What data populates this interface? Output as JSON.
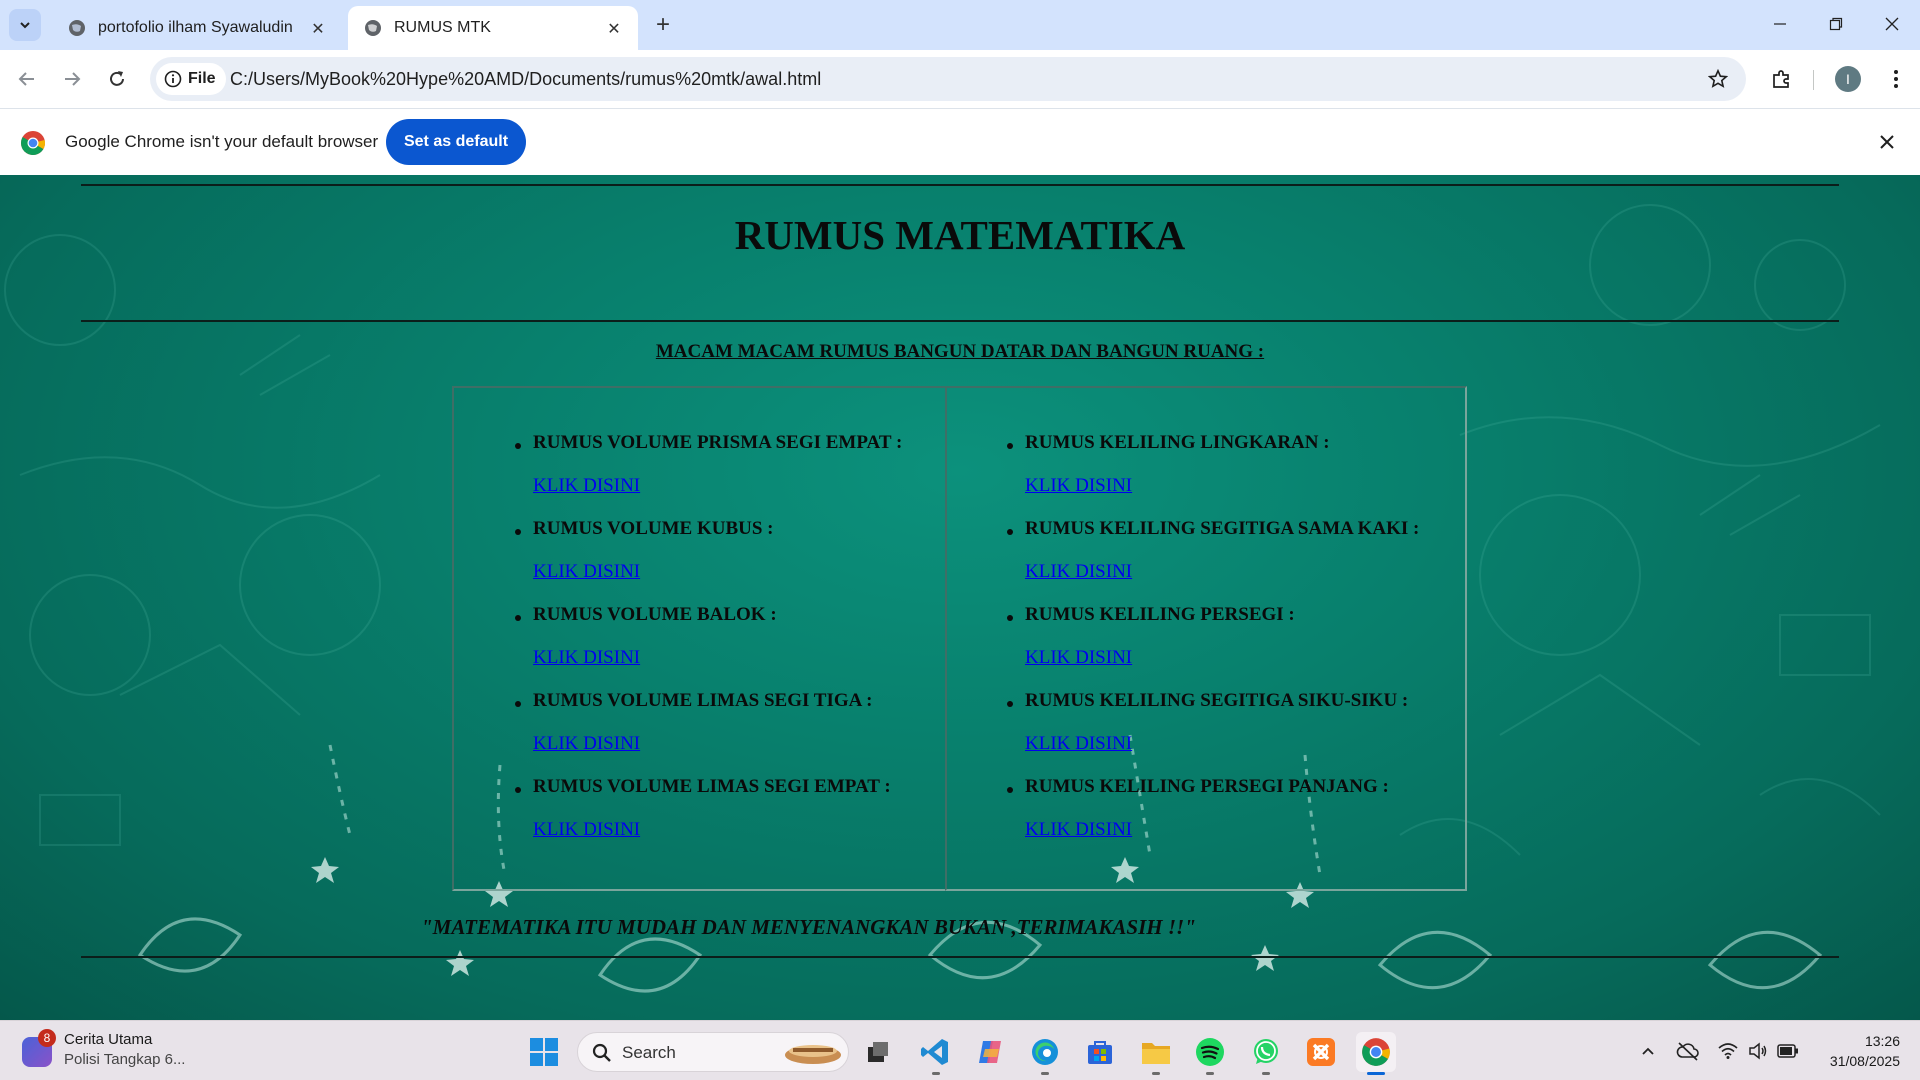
{
  "browser": {
    "tabs": [
      {
        "title": "portofolio ilham Syawaludin",
        "active": false
      },
      {
        "title": "RUMUS MTK",
        "active": true
      }
    ],
    "address": {
      "scheme_chip": "File",
      "url": "C:/Users/MyBook%20Hype%20AMD/Documents/rumus%20mtk/awal.html"
    },
    "profile_initial": "I",
    "infobar": {
      "message": "Google Chrome isn't your default browser",
      "button": "Set as default"
    }
  },
  "page": {
    "title": "RUMUS MATEMATIKA",
    "subtitle": "MACAM MACAM RUMUS BANGUN DATAR DAN BANGUN RUANG :",
    "left_column": [
      {
        "label": "RUMUS VOLUME PRISMA SEGI EMPAT :",
        "link": "KLIK DISINI"
      },
      {
        "label": "RUMUS VOLUME KUBUS :",
        "link": "KLIK DISINI"
      },
      {
        "label": "RUMUS VOLUME BALOK :",
        "link": "KLIK DISINI"
      },
      {
        "label": "RUMUS VOLUME LIMAS SEGI TIGA :",
        "link": "KLIK DISINI"
      },
      {
        "label": "RUMUS VOLUME LIMAS SEGI EMPAT :",
        "link": "KLIK DISINI"
      }
    ],
    "right_column": [
      {
        "label": "RUMUS KELILING LINGKARAN :",
        "link": "KLIK DISINI"
      },
      {
        "label": "RUMUS KELILING SEGITIGA SAMA KAKI :",
        "link": "KLIK DISINI"
      },
      {
        "label": "RUMUS KELILING PERSEGI :",
        "link": "KLIK DISINI"
      },
      {
        "label": "RUMUS KELILING SEGITIGA SIKU-SIKU :",
        "link": "KLIK DISINI"
      },
      {
        "label": "RUMUS KELILING PERSEGI PANJANG :",
        "link": "KLIK DISINI"
      }
    ],
    "quote": "\"MATEMATIKA ITU MUDAH DAN MENYENANGKAN BUKAN ,TERIMAKASIH !!\"",
    "colors": {
      "background": "#08806d",
      "text": "#0a0a0a",
      "link": "#0000ee"
    }
  },
  "taskbar": {
    "news": {
      "badge": "8",
      "title": "Cerita Utama",
      "subtitle": "Polisi Tangkap 6..."
    },
    "search_label": "Search",
    "apps": [
      "start-icon",
      "search-icon",
      "task-view-icon",
      "vscode-icon",
      "copilot-icon",
      "edge-icon",
      "store-icon",
      "file-explorer-icon",
      "spotify-icon",
      "whatsapp-icon",
      "xampp-icon",
      "chrome-icon"
    ],
    "clock": {
      "time": "13:26",
      "date": "31/08/2025"
    }
  }
}
